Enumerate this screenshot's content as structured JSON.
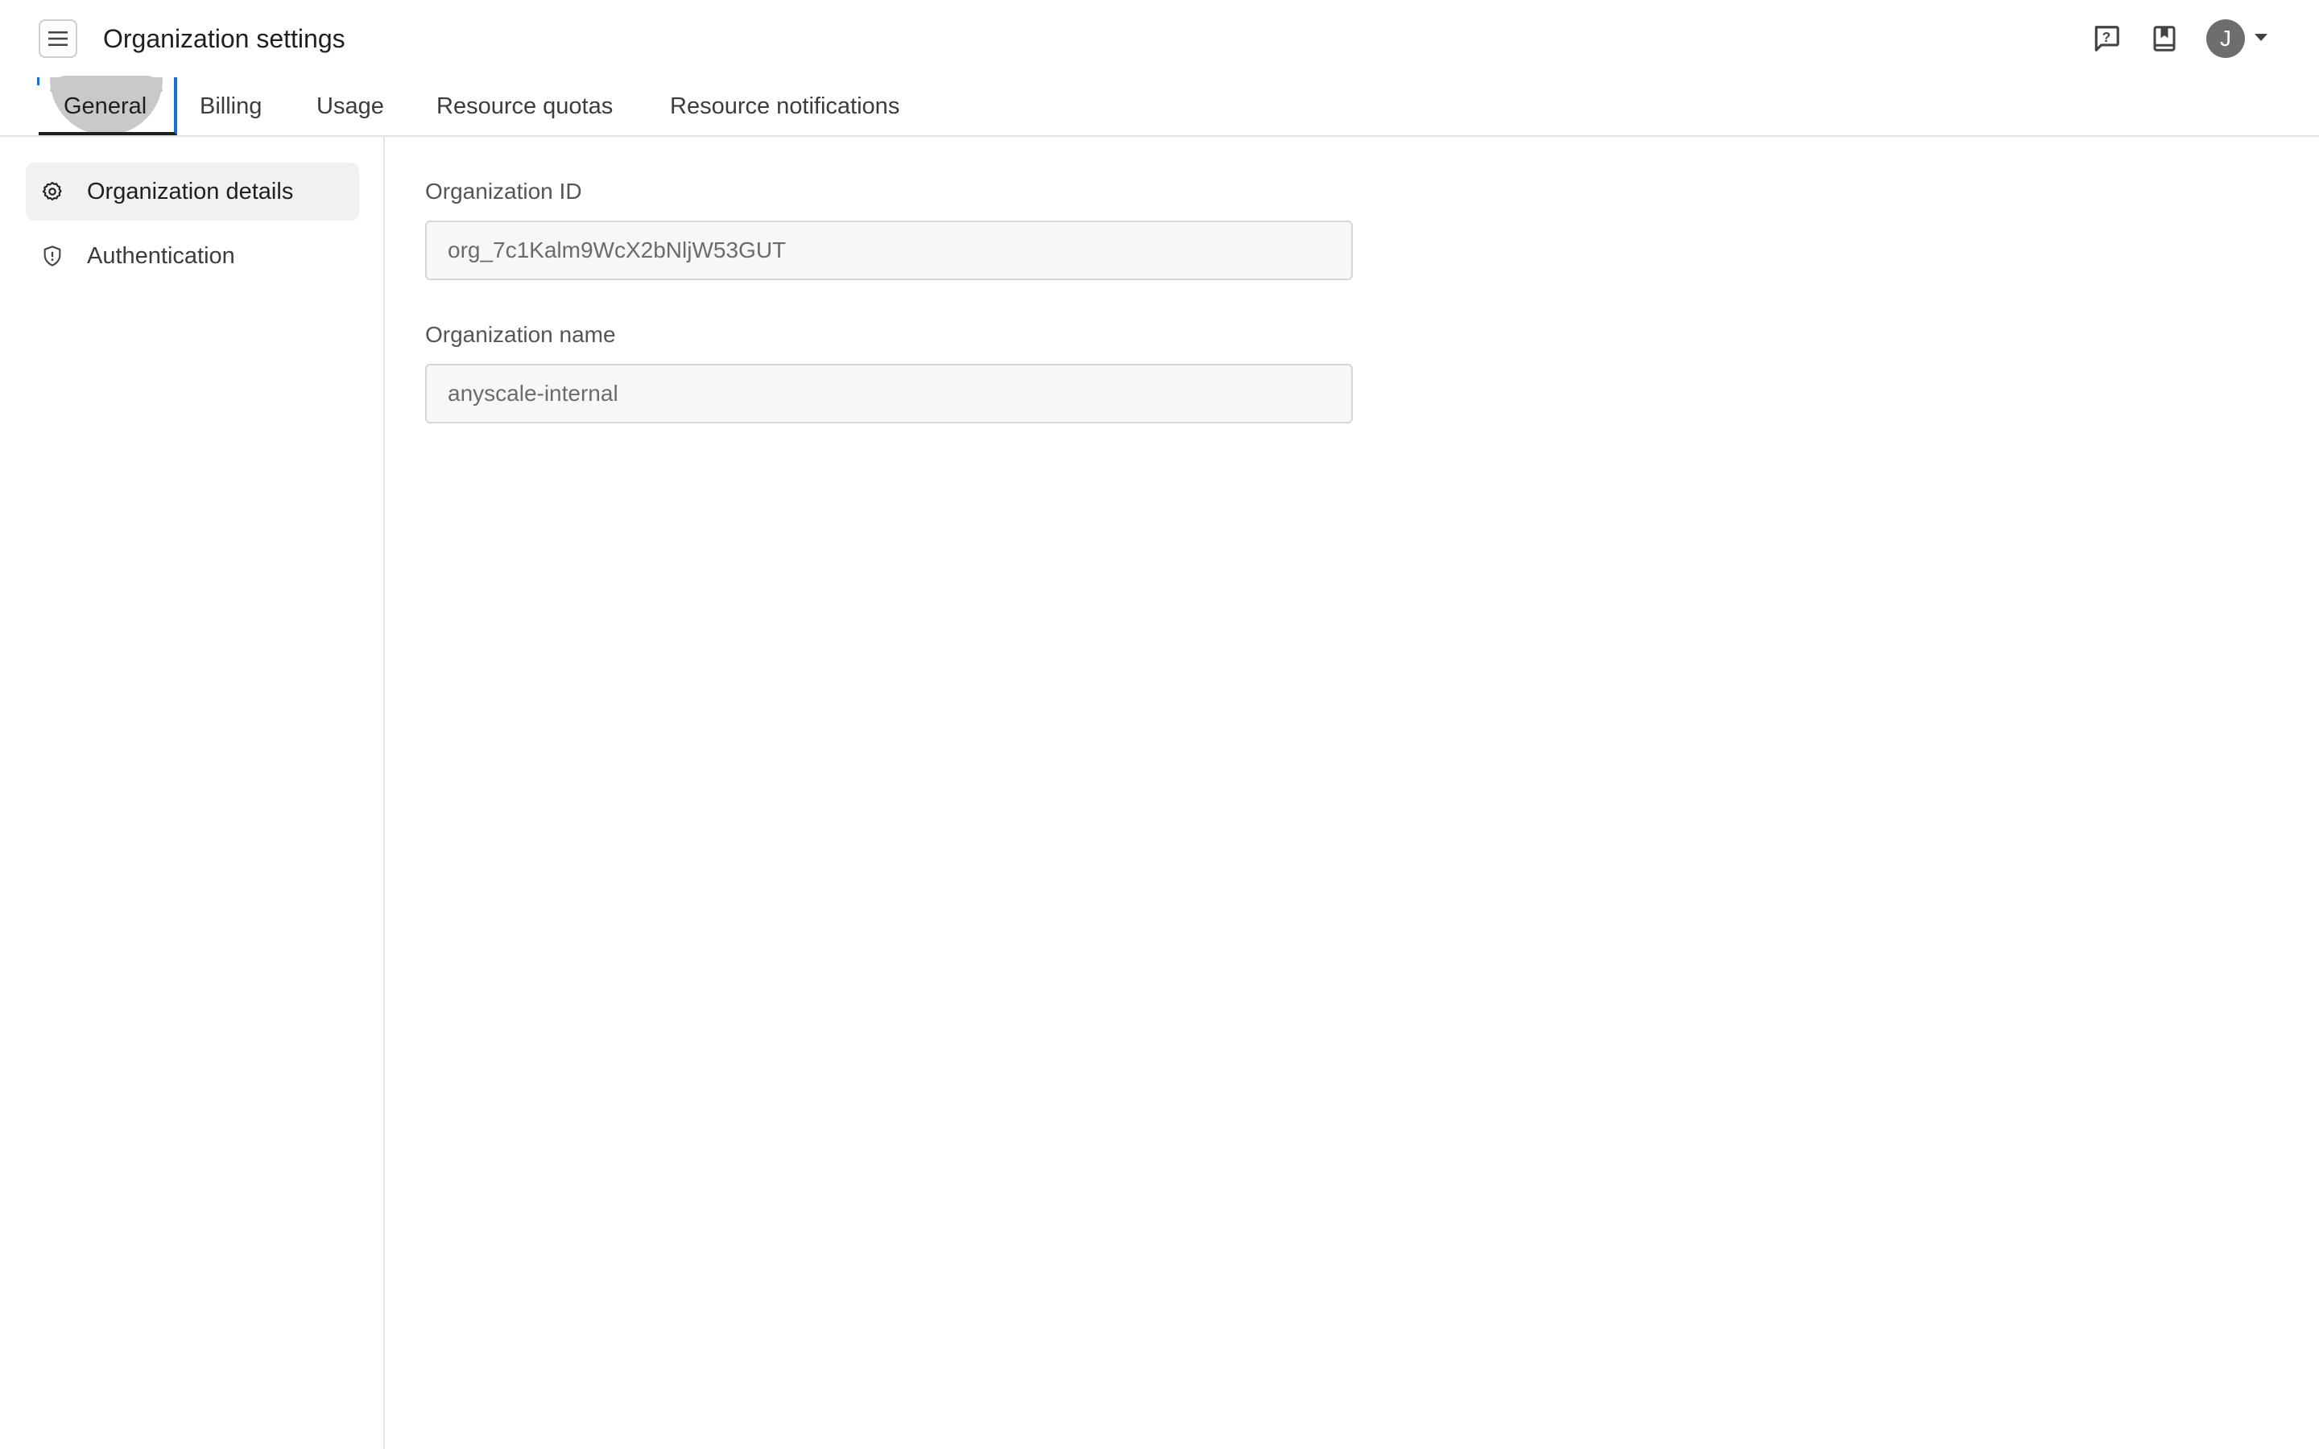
{
  "header": {
    "title": "Organization settings",
    "menu_icon": "hamburger-menu-icon",
    "help_icon": "help-chat-icon",
    "docs_icon": "bookmark-book-icon",
    "avatar_initial": "J"
  },
  "tabs": [
    {
      "label": "General",
      "active": true
    },
    {
      "label": "Billing",
      "active": false
    },
    {
      "label": "Usage",
      "active": false
    },
    {
      "label": "Resource quotas",
      "active": false
    },
    {
      "label": "Resource notifications",
      "active": false
    }
  ],
  "sidebar": {
    "items": [
      {
        "label": "Organization details",
        "icon": "gear-icon",
        "active": true
      },
      {
        "label": "Authentication",
        "icon": "shield-icon",
        "active": false
      }
    ]
  },
  "form": {
    "org_id_label": "Organization ID",
    "org_id_value": "org_7c1Kalm9WcX2bNljW53GUT",
    "org_name_label": "Organization name",
    "org_name_value": "anyscale-internal"
  },
  "colors": {
    "active_tab_accent": "#1a6fd6",
    "active_sidebar_bg": "#f0f1f2",
    "input_bg": "#f6f7f8"
  }
}
